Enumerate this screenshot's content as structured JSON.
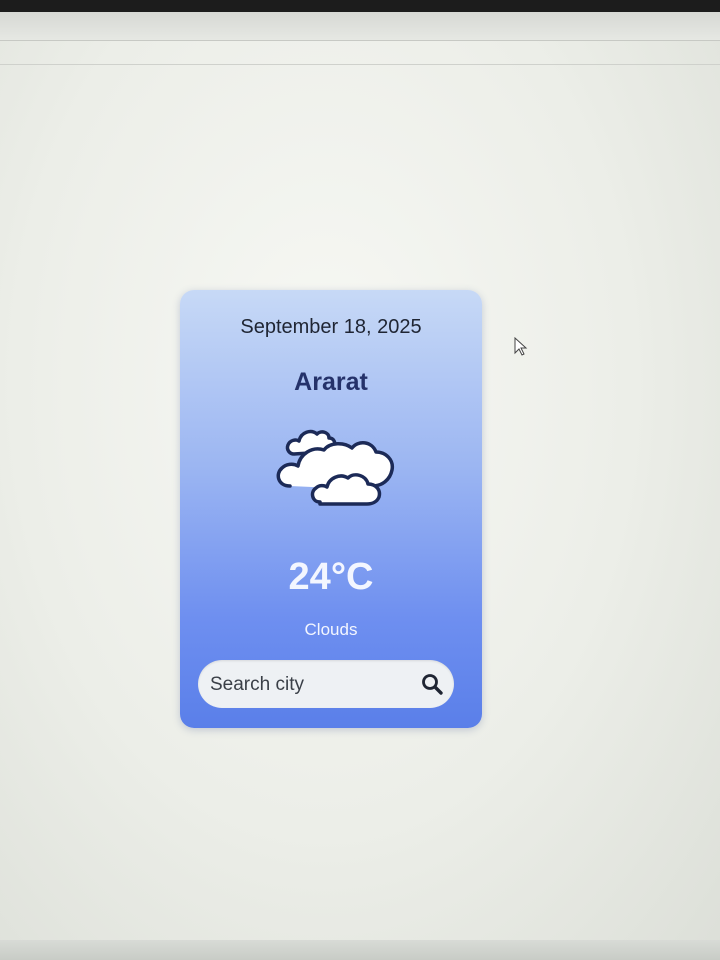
{
  "weather": {
    "date": "September 18, 2025",
    "city": "Ararat",
    "icon": "cloudy-icon",
    "temperature": "24°C",
    "condition": "Clouds"
  },
  "search": {
    "placeholder": "Search city",
    "value": "",
    "button_icon": "search-icon"
  },
  "colors": {
    "card_gradient_top": "#c7d9f6",
    "card_gradient_bottom": "#5a7fe9",
    "city_text": "#25326a",
    "temperature_text": "#f3f6ff"
  }
}
